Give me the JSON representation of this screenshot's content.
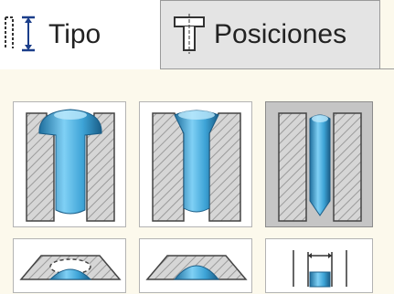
{
  "tabs": [
    {
      "label": "Tipo",
      "icon": "tipo-dimension-icon",
      "active": true
    },
    {
      "label": "Posiciones",
      "icon": "posiciones-hole-icon",
      "active": false
    }
  ],
  "hole_types": [
    {
      "icon": "counterbore-hole-icon",
      "selected": false
    },
    {
      "icon": "countersink-hole-icon",
      "selected": false
    },
    {
      "icon": "straight-hole-icon",
      "selected": true
    },
    {
      "icon": "straight-tap-hole-icon",
      "selected": false
    },
    {
      "icon": "tapered-tap-hole-icon",
      "selected": false
    },
    {
      "icon": "legacy-hole-icon",
      "selected": false
    }
  ],
  "colors": {
    "background": "#fcf9ec",
    "selected_cell": "#c5c5c5",
    "hole_blue": "#3da3d6"
  }
}
